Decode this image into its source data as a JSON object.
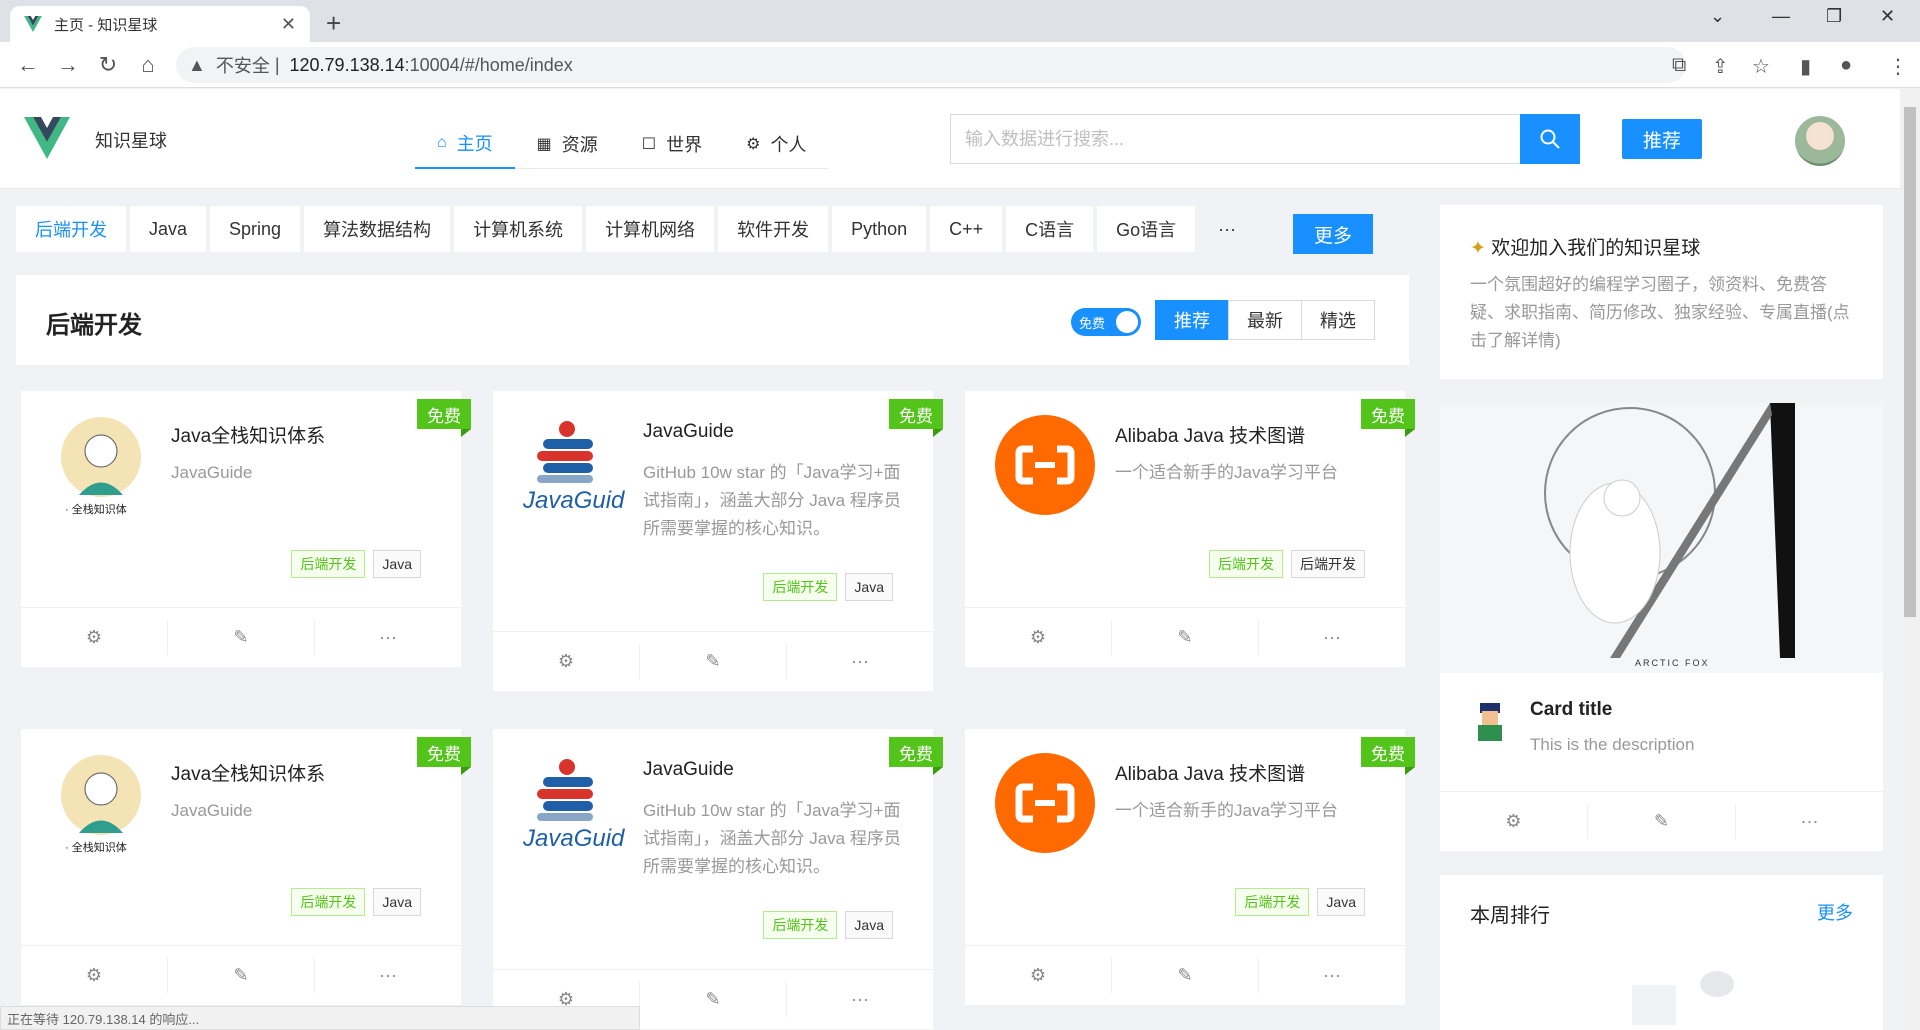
{
  "browser": {
    "tab_title": "主页 - 知识星球",
    "tab_close": "✕",
    "new_tab": "+",
    "security_label": "不安全",
    "url_host": "120.79.138.14",
    "url_path": ":10004/#/home/index",
    "status_text": "正在等待 120.79.138.14 的响应..."
  },
  "header": {
    "site_name": "知识星球",
    "menu": [
      {
        "label": "主页",
        "icon": "home-icon"
      },
      {
        "label": "资源",
        "icon": "grid-icon"
      },
      {
        "label": "世界",
        "icon": "square-icon"
      },
      {
        "label": "个人",
        "icon": "gear-icon"
      }
    ],
    "search_placeholder": "输入数据进行搜索...",
    "recommend_label": "推荐"
  },
  "categories": [
    "后端开发",
    "Java",
    "Spring",
    "算法数据结构",
    "计算机系统",
    "计算机网络",
    "软件开发",
    "Python",
    "C++",
    "C语言",
    "Go语言",
    "···"
  ],
  "more_label": "更多",
  "section": {
    "title": "后端开发",
    "toggle_label": "免费",
    "segments": [
      "推荐",
      "最新",
      "精选"
    ]
  },
  "cards": [
    {
      "title": "Java全栈知识体系",
      "desc": "JavaGuide",
      "badge": "免费",
      "tags": [
        "后端开发",
        "Java"
      ],
      "logo_text": "· 全栈知识体"
    },
    {
      "title": "JavaGuide",
      "desc": "GitHub 10w star 的「Java学习+面试指南」，涵盖大部分 Java 程序员所需要掌握的核心知识。",
      "badge": "免费",
      "tags": [
        "后端开发",
        "Java"
      ],
      "logo_text": "JavaGuid"
    },
    {
      "title": "Alibaba Java 技术图谱",
      "desc": "一个适合新手的Java学习平台",
      "badge": "免费",
      "tags": [
        "后端开发",
        "后端开发"
      ]
    },
    {
      "title": "Java全栈知识体系",
      "desc": "JavaGuide",
      "badge": "免费",
      "tags": [
        "后端开发",
        "Java"
      ],
      "logo_text": "· 全栈知识体"
    },
    {
      "title": "JavaGuide",
      "desc": "GitHub 10w star 的「Java学习+面试指南」，涵盖大部分 Java 程序员所需要掌握的核心知识。",
      "badge": "免费",
      "tags": [
        "后端开发",
        "Java"
      ],
      "logo_text": "JavaGuid"
    },
    {
      "title": "Alibaba Java 技术图谱",
      "desc": "一个适合新手的Java学习平台",
      "badge": "免费",
      "tags": [
        "后端开发",
        "Java"
      ]
    }
  ],
  "sidebar": {
    "join_title": "欢迎加入我们的知识星球",
    "join_desc": "一个氛围超好的编程学习圈子，领资料、免费答疑、求职指南、简历修改、独家经验、专属直播(点击了解详情)",
    "cover_caption": "ARCTIC FOX",
    "meta_title": "Card title",
    "meta_desc": "This is the description",
    "rank_title": "本周排行",
    "rank_more": "更多"
  },
  "colors": {
    "primary": "#1890ff",
    "free_badge": "#52c41a",
    "alibaba": "#ff6a00"
  }
}
